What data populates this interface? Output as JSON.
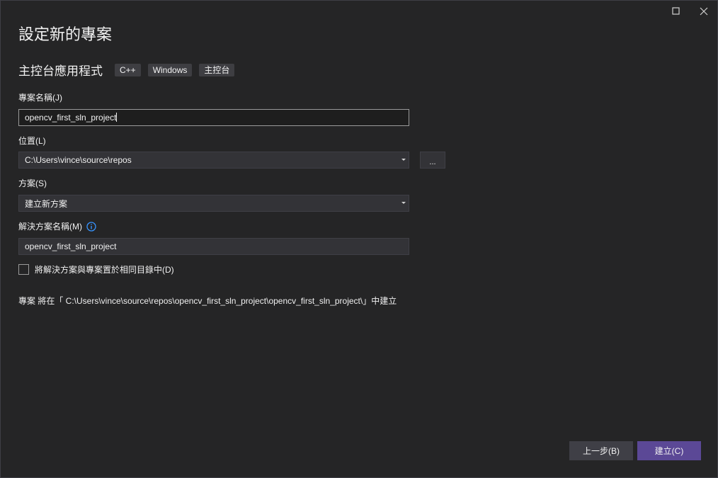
{
  "window": {
    "maximize_icon": "maximize-icon",
    "close_icon": "close-icon"
  },
  "title": "設定新的專案",
  "template": {
    "name": "主控台應用程式",
    "tags": [
      "C++",
      "Windows",
      "主控台"
    ]
  },
  "form": {
    "project_name_label": "專案名稱(J)",
    "project_name_value": "opencv_first_sln_project",
    "location_label": "位置(L)",
    "location_value": "C:\\Users\\vince\\source\\repos",
    "browse_label": "...",
    "solution_label": "方案(S)",
    "solution_value": "建立新方案",
    "solution_name_label": "解決方案名稱(M)",
    "solution_name_value": "opencv_first_sln_project",
    "same_dir_label": "將解決方案與專案置於相同目錄中(D)",
    "same_dir_checked": false
  },
  "info_text": "專案 將在「 C:\\Users\\vince\\source\\repos\\opencv_first_sln_project\\opencv_first_sln_project\\」中建立",
  "buttons": {
    "back": "上一步(B)",
    "create": "建立(C)"
  },
  "colors": {
    "background": "#252526",
    "accent": "#5b4896",
    "info_icon": "#3794ff"
  }
}
